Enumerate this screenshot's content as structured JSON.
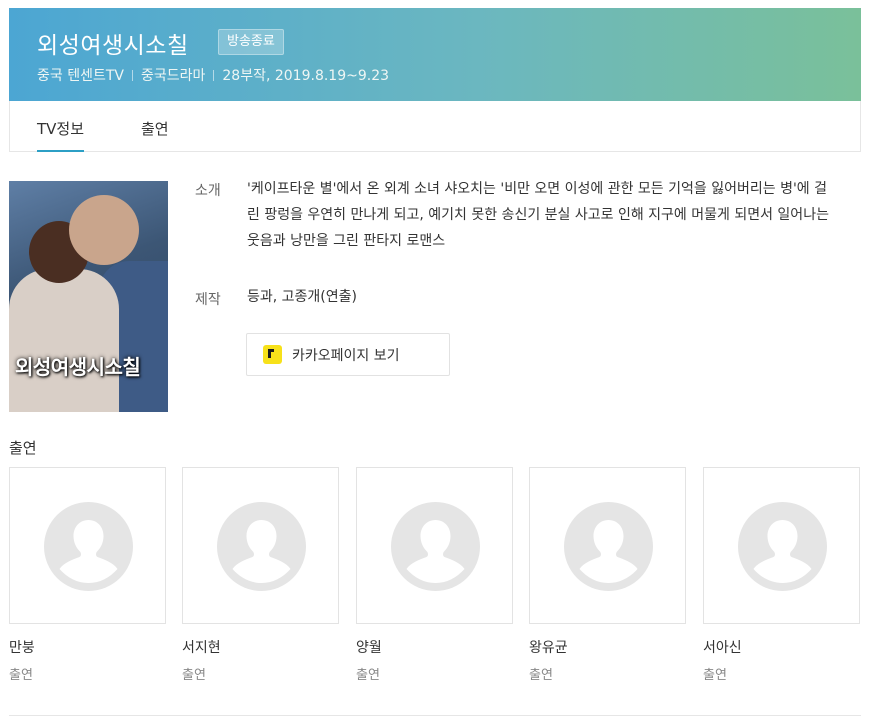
{
  "header": {
    "title": "외성여생시소칠",
    "badge": "방송종료",
    "channel": "중국 텐센트TV",
    "genre": "중국드라마",
    "episodes_dates": "28부작, 2019.8.19~9.23"
  },
  "tabs": [
    {
      "label": "TV정보",
      "active": true
    },
    {
      "label": "출연",
      "active": false
    }
  ],
  "poster": {
    "title_text": "외성여생시소칠"
  },
  "info": {
    "synopsis_label": "소개",
    "synopsis": "'케이프타운 별'에서 온 외계 소녀 샤오치는 '비만 오면 이성에 관한 모든 기억을 잃어버리는 병'에 걸린 팡렁을 우연히 만나게 되고, 예기치 못한 송신기 분실 사고로 인해 지구에 머물게 되면서 일어나는 웃음과 낭만을 그린 판타지 로맨스",
    "production_label": "제작",
    "production": "등과, 고종개(연출)",
    "kakao_button": "카카오페이지 보기",
    "kakao_icon": "kakao-page-icon"
  },
  "cast": {
    "heading": "출연",
    "members": [
      {
        "name": "만붕",
        "role": "출연"
      },
      {
        "name": "서지현",
        "role": "출연"
      },
      {
        "name": "양월",
        "role": "출연"
      },
      {
        "name": "왕유균",
        "role": "출연"
      },
      {
        "name": "서아신",
        "role": "출연"
      }
    ]
  },
  "colors": {
    "header_gradient_start": "#4ca6d3",
    "header_gradient_end": "#7ac09a",
    "tab_active_underline": "#2c9fc5",
    "kakao_yellow": "#f7e11a"
  }
}
